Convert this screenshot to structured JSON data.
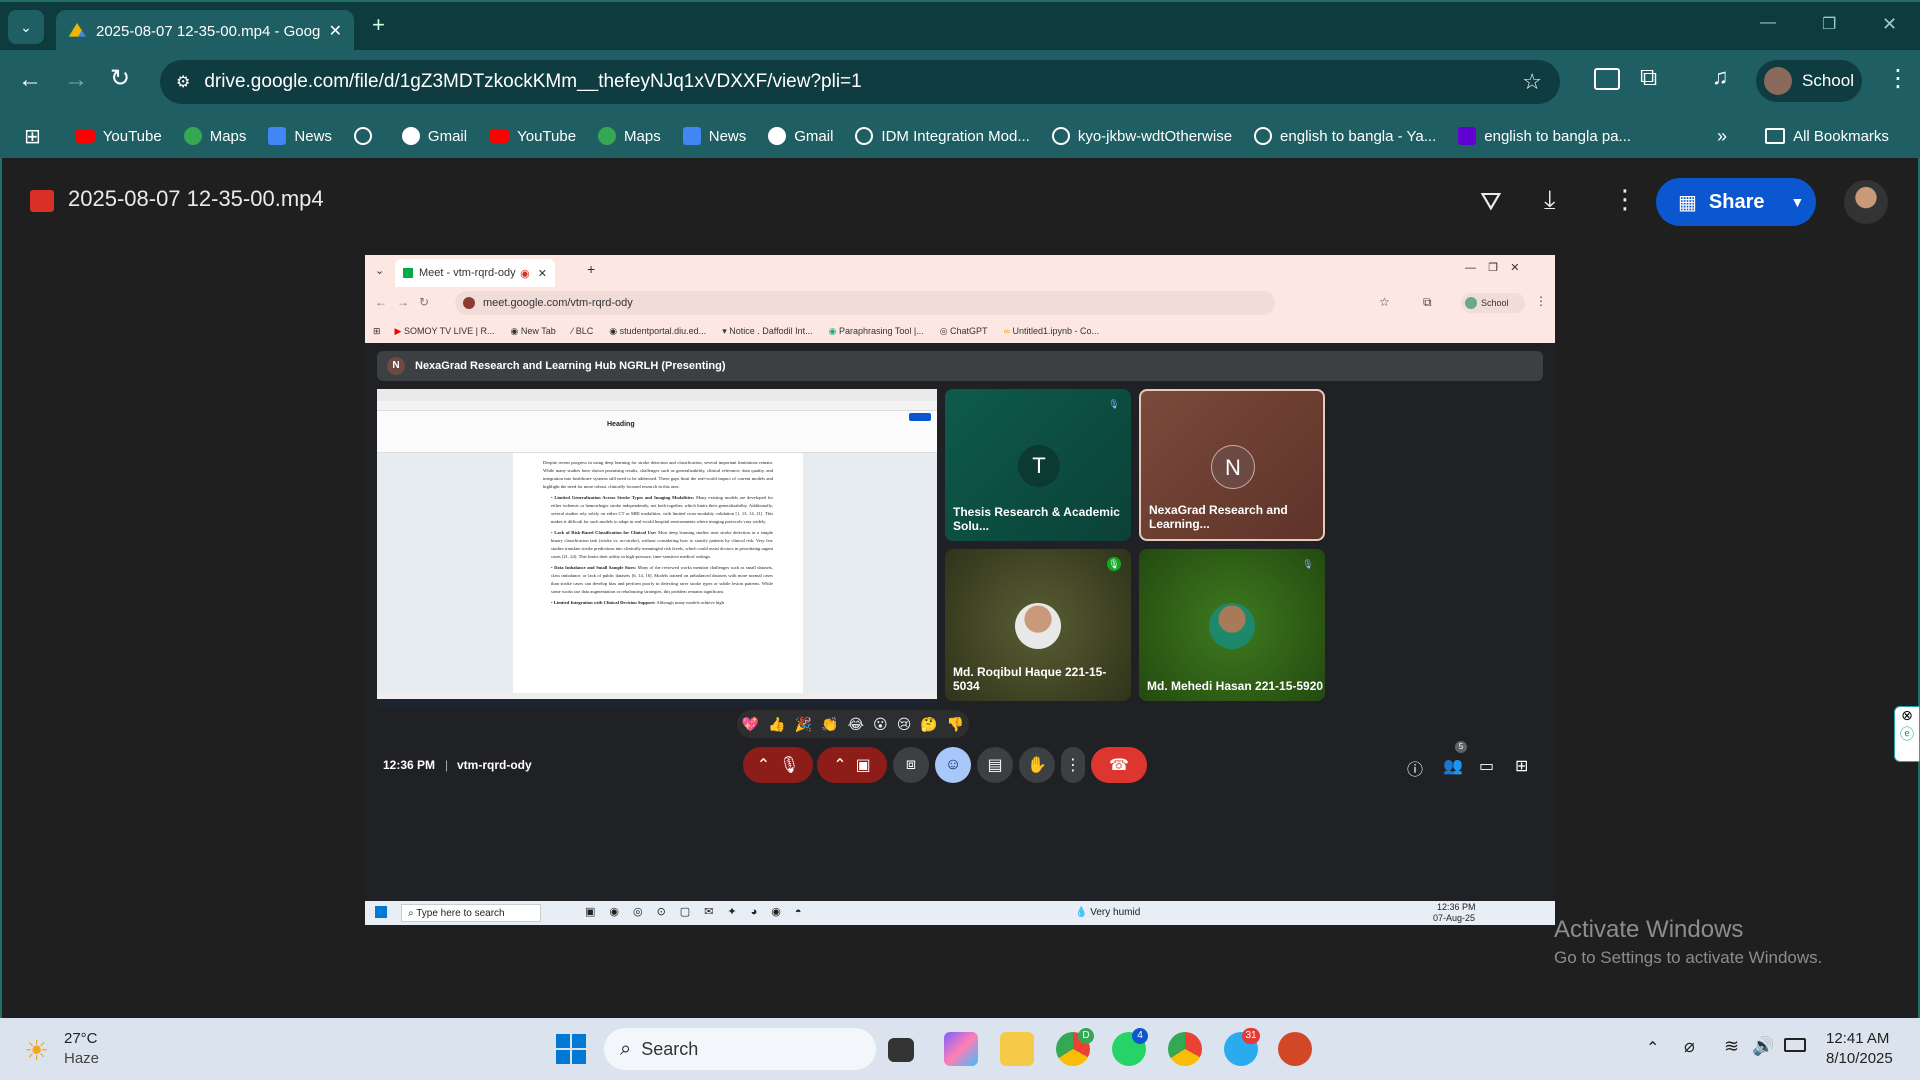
{
  "browser": {
    "tab_title": "2025-08-07 12-35-00.mp4 - Goog",
    "url": "drive.google.com/file/d/1gZ3MDTzkockKMm__thefeyNJq1xVDXXF/view?pli=1",
    "profile_label": "School",
    "bookmarks": [
      "YouTube",
      "Maps",
      "News",
      "",
      "Gmail",
      "YouTube",
      "Maps",
      "News",
      "Gmail",
      "IDM Integration Mod...",
      "kyo-jkbw-wdtOtherwise",
      "english to bangla - Ya...",
      "english to bangla pa..."
    ],
    "all_bookmarks": "All Bookmarks"
  },
  "drive": {
    "file_title": "2025-08-07 12-35-00.mp4",
    "share_label": "Share"
  },
  "video": {
    "inner_tab_title": "Meet - vtm-rqrd-ody",
    "inner_url": "meet.google.com/vtm-rqrd-ody",
    "inner_profile": "School",
    "inner_bookmarks": [
      "SOMOY TV LIVE | R...",
      "New Tab",
      "BLC",
      "studentportal.diu.ed...",
      "Notice . Daffodil Int...",
      "Paraphrasing Tool |...",
      "ChatGPT",
      "Untitled1.ipynb - Co..."
    ],
    "presenting": "NexaGrad Research and Learning Hub NGRLH (Presenting)",
    "presenter_initial": "N",
    "participants": [
      {
        "initial": "T",
        "name": "Thesis Research & Academic Solu..."
      },
      {
        "initial": "N",
        "name": "NexaGrad Research and Learning..."
      },
      {
        "initial": "",
        "name": "Md. Roqibul Haque 221-15-5034"
      },
      {
        "initial": "",
        "name": "Md. Mehedi Hasan 221-15-5920"
      }
    ],
    "time": "12:36 PM",
    "meeting_code": "vtm-rqrd-ody",
    "people_count": "5",
    "reactions": [
      "💖",
      "👍",
      "🎉",
      "👏",
      "😂",
      "😮",
      "😢",
      "🤔",
      "👎"
    ],
    "doc": {
      "heading": "Heading",
      "paragraph1": "Despite recent progress in using deep learning for stroke detection and classification, several important limitations remain. While many studies have shown promising results, challenges such as generalizability, clinical relevance, data quality, and integration into healthcare systems still need to be addressed. These gaps limit the real-world impact of current models and highlight the need for more robust, clinically focused research in this area.",
      "bullets": [
        {
          "title": "Limited Generalization Across Stroke Types and Imaging Modalities:",
          "text": " Many existing models are developed for either ischemic or hemorrhagic stroke independently, not both together, which limits their generalizability. Additionally, several studies rely solely on either CT or MRI modalities, with limited cross-modality validation [1, 13, 14, 21]. This makes it difficult for such models to adapt in real-world hospital environments where imaging protocols vary widely."
        },
        {
          "title": "Lack of Risk-Based Classification for Clinical Use:",
          "text": " Most deep learning studies treat stroke detection as a simple binary classification task (stroke vs. no-stroke), without considering how to stratify patients by clinical risk. Very few studies translate stroke predictions into clinically meaningful risk levels, which could assist doctors in prioritizing urgent cases [21, 24]. This limits their utility in high-pressure, time-sensitive medical settings."
        },
        {
          "title": "Data Imbalance and Small Sample Sizes:",
          "text": " Many of the reviewed works mention challenges such as small datasets, class imbalance, or lack of public datasets [6, 14, 16]. Models trained on unbalanced datasets with more normal cases than stroke cases can develop bias and perform poorly in detecting rarer stroke types or subtle lesion patterns. While some works use data augmentation or rebalancing strategies, this problem remains significant."
        },
        {
          "title": "Limited Integration with Clinical Decision Support:",
          "text": " Although many models achieve high"
        }
      ]
    },
    "inner_taskbar": {
      "search_placeholder": "Type here to search",
      "weather": "Very humid",
      "time": "12:36 PM",
      "date": "07-Aug-25"
    }
  },
  "watermark": {
    "line1": "Activate Windows",
    "line2": "Go to Settings to activate Windows."
  },
  "taskbar": {
    "temp": "27°C",
    "condition": "Haze",
    "search": "Search",
    "time": "12:41 AM",
    "date": "8/10/2025",
    "badges": {
      "chrome_profile": "D",
      "whatsapp": "4",
      "telegram": "31"
    }
  }
}
